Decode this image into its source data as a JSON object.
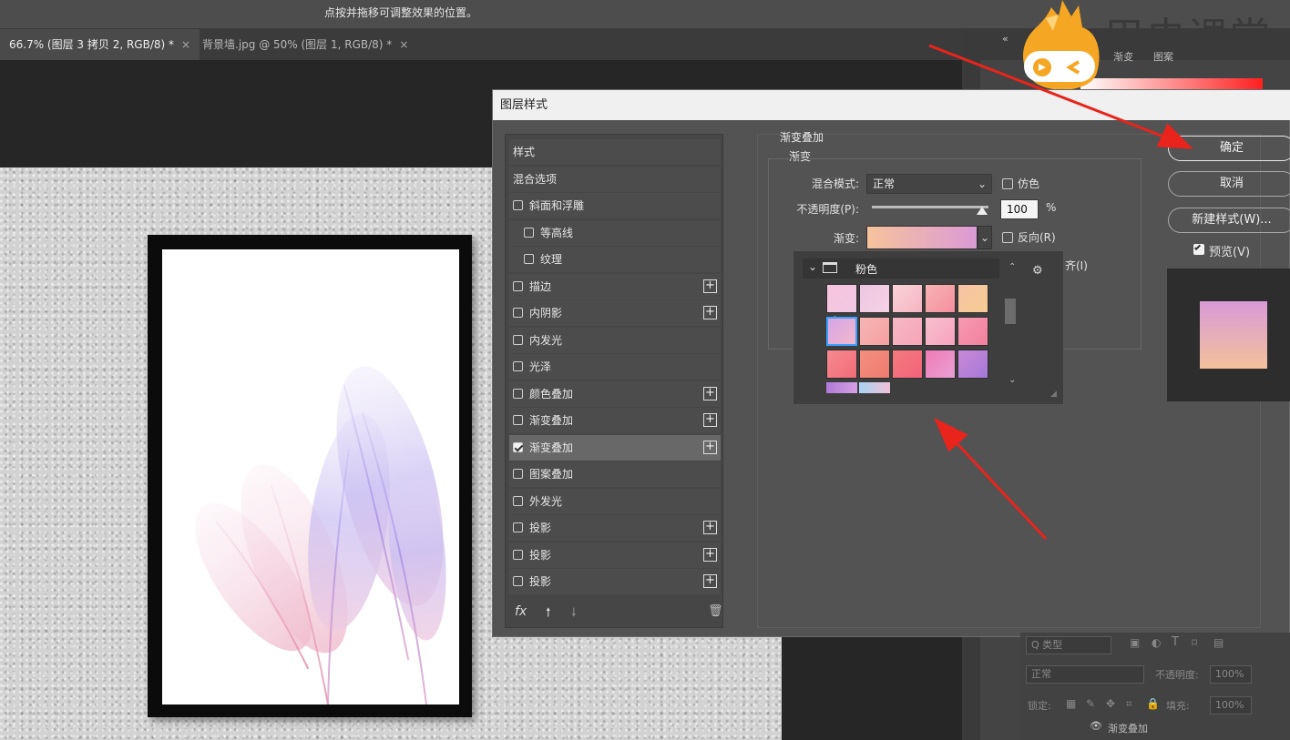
{
  "top_hint": "点按并拖移可调整效果的位置。",
  "tabs": [
    {
      "label": "66.7% (图层 3 拷贝 2, RGB/8) *",
      "close": "×"
    },
    {
      "label": "背景墙.jpg @ 50% (图层 1, RGB/8) *",
      "close": "×"
    }
  ],
  "dialog": {
    "title": "图层样式",
    "style_list": [
      {
        "label": "样式",
        "checkbox": false,
        "plus": false
      },
      {
        "label": "混合选项",
        "checkbox": false,
        "plus": false
      },
      {
        "label": "斜面和浮雕",
        "checkbox": true,
        "checked": false,
        "plus": false
      },
      {
        "label": "等高线",
        "checkbox": true,
        "checked": false,
        "plus": false,
        "indent": true
      },
      {
        "label": "纹理",
        "checkbox": true,
        "checked": false,
        "plus": false,
        "indent": true
      },
      {
        "label": "描边",
        "checkbox": true,
        "checked": false,
        "plus": true
      },
      {
        "label": "内阴影",
        "checkbox": true,
        "checked": false,
        "plus": true
      },
      {
        "label": "内发光",
        "checkbox": true,
        "checked": false,
        "plus": false
      },
      {
        "label": "光泽",
        "checkbox": true,
        "checked": false,
        "plus": false
      },
      {
        "label": "颜色叠加",
        "checkbox": true,
        "checked": false,
        "plus": true
      },
      {
        "label": "渐变叠加",
        "checkbox": true,
        "checked": false,
        "plus": true
      },
      {
        "label": "渐变叠加",
        "checkbox": true,
        "checked": true,
        "plus": true,
        "selected": true
      },
      {
        "label": "图案叠加",
        "checkbox": true,
        "checked": false,
        "plus": false
      },
      {
        "label": "外发光",
        "checkbox": true,
        "checked": false,
        "plus": false
      },
      {
        "label": "投影",
        "checkbox": true,
        "checked": false,
        "plus": true
      },
      {
        "label": "投影",
        "checkbox": true,
        "checked": false,
        "plus": true
      },
      {
        "label": "投影",
        "checkbox": true,
        "checked": false,
        "plus": true
      }
    ],
    "footer_fx": "fx",
    "group_title": "渐变叠加",
    "sub_title": "渐变",
    "blend_mode_label": "混合模式:",
    "blend_mode_value": "正常",
    "dither_label": "仿色",
    "opacity_label": "不透明度(P):",
    "opacity_value": "100",
    "percent": "%",
    "opacity_level": 1.0,
    "gradient_label": "渐变:",
    "reverse_label": "反向(R)",
    "align_label_partial": "齐(I)",
    "preset_folder": "粉色",
    "buttons": {
      "ok": "确定",
      "cancel": "取消",
      "new_style": "新建样式(W)...",
      "preview": "预览(V)"
    }
  },
  "swatches": [
    [
      "#f7c4dc",
      "#f0c8e4"
    ],
    [
      "#ecc6e0",
      "#f6d2e6"
    ],
    [
      "#f8d3d8",
      "#f6b4c3"
    ],
    [
      "#f7b3b4",
      "#f58f9e"
    ],
    [
      "#f7c2a6",
      "#f6cd92"
    ],
    [
      "#d4a6e8",
      "#f3b7cb"
    ],
    [
      "#f5b5b5",
      "#f7a0a0"
    ],
    [
      "#f7b8c4",
      "#f5a5b8"
    ],
    [
      "#f7c0cf",
      "#f8a2bd"
    ],
    [
      "#f79ab2",
      "#f2809d"
    ],
    [
      "#f58a8f",
      "#f26b78"
    ],
    [
      "#f39080",
      "#ef7a70"
    ],
    [
      "#f47a7e",
      "#f2647a"
    ],
    [
      "#f07bb5",
      "#e8a0d4"
    ],
    [
      "#c98ad8",
      "#a578d8"
    ]
  ],
  "layers_panel": {
    "kind_placeholder": "Q 类型",
    "blend": "正常",
    "opacity_label": "不透明度:",
    "opacity_value": "100%",
    "lock_label": "锁定:",
    "fill_label": "填充:",
    "fill_value": "100%",
    "layer_name": "渐变叠加"
  },
  "logo": {
    "text": "甲虫课堂"
  },
  "right_panel_labels": [
    "渐变",
    "图案"
  ],
  "colors": {
    "accent_arrow": "#e8241c",
    "selected_swatch_border": "#3aa0ff"
  }
}
